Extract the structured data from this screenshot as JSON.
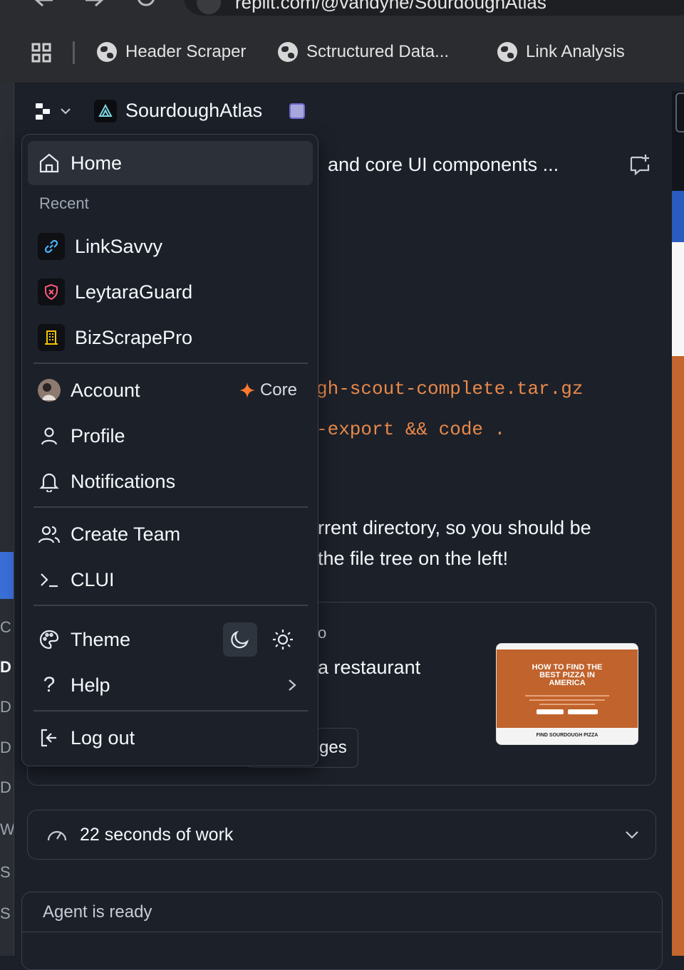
{
  "browser": {
    "url": "replit.com/@vandyne/SourdoughAtlas",
    "bookmarks": [
      {
        "label": "Header Scraper",
        "icon": "globe-icon"
      },
      {
        "label": "Sctructured Data...",
        "icon": "globe-icon"
      },
      {
        "label": "Link Analysis",
        "icon": "globe-icon"
      }
    ]
  },
  "left_rail": {
    "letters": [
      "C",
      "D",
      "D",
      "D",
      "D",
      "W",
      "S",
      "S"
    ]
  },
  "header": {
    "project_name": "SourdoughAtlas"
  },
  "chat": {
    "line1": "and core UI components ...",
    "code1": "gh-scout-complete.tar.gz",
    "code2": "-export && code .",
    "para1": "rrent directory, so you should be",
    "para2": "the file tree on the left!",
    "card_title_frag": "o",
    "card_text": "a restaurant",
    "card_button": "ges",
    "preview": {
      "hero_title": "HOW TO FIND THE BEST PIZZA IN AMERICA",
      "section_title": "FIND SOURDOUGH PIZZA"
    },
    "work_summary": "22 seconds of work",
    "agent_status": "Agent is ready"
  },
  "menu": {
    "home": "Home",
    "recent_heading": "Recent",
    "recent": [
      {
        "label": "LinkSavvy",
        "icon": "link-icon",
        "color": "#4fb3ff"
      },
      {
        "label": "LeytaraGuard",
        "icon": "shield-icon",
        "color": "#ff5a7a"
      },
      {
        "label": "BizScrapePro",
        "icon": "building-icon",
        "color": "#f5c400"
      }
    ],
    "account": "Account",
    "plan": "Core",
    "profile": "Profile",
    "notifications": "Notifications",
    "create_team": "Create Team",
    "clui": "CLUI",
    "theme": "Theme",
    "help": "Help",
    "logout": "Log out"
  },
  "colors": {
    "background": "#1c2029",
    "accent_orange": "#e9894a",
    "plan_star": "#ff7a2e"
  }
}
